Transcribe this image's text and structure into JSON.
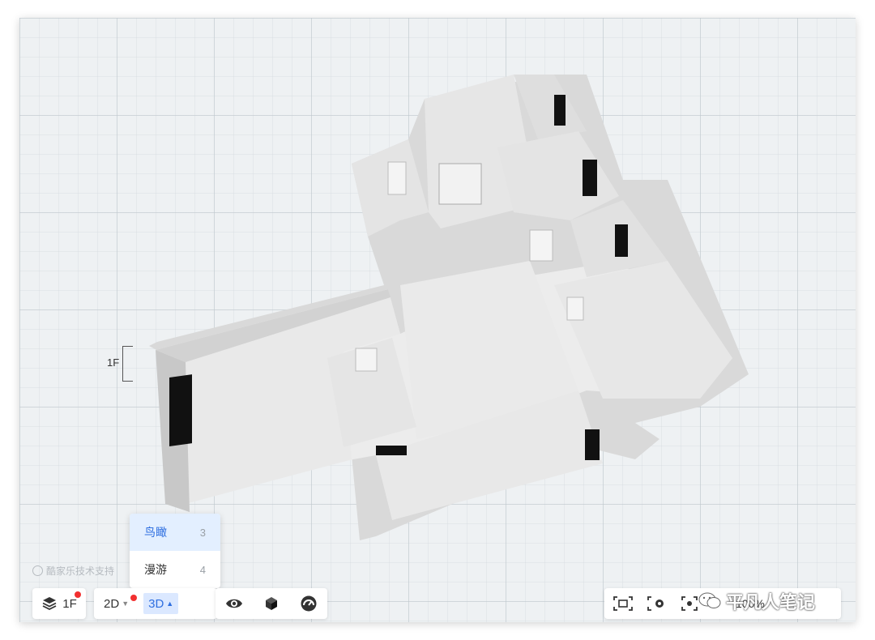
{
  "floor": {
    "label": "1F"
  },
  "watermark": {
    "text": "酷家乐技术支持"
  },
  "view_menu": {
    "items": [
      {
        "label": "鸟瞰",
        "count": "3"
      },
      {
        "label": "漫游",
        "count": "4"
      }
    ]
  },
  "toolbar": {
    "floor_button_label": "1F",
    "mode_2d_label": "2D",
    "mode_3d_label": "3D",
    "zoom_label": "100%"
  },
  "overlay": {
    "wechat_text": "平凡人笔记"
  },
  "icons": [
    "layers-icon",
    "eye-icon",
    "cube-icon",
    "gauge-icon",
    "crop-view-icon",
    "view-settings-icon",
    "focus-icon",
    "wechat-icon",
    "caret-down-icon",
    "caret-up-icon"
  ],
  "colors": {
    "accent": "#2f6fe0",
    "active_bg": "#dbe8ff",
    "badge": "#f23030",
    "grid_bg": "#eef1f3"
  }
}
